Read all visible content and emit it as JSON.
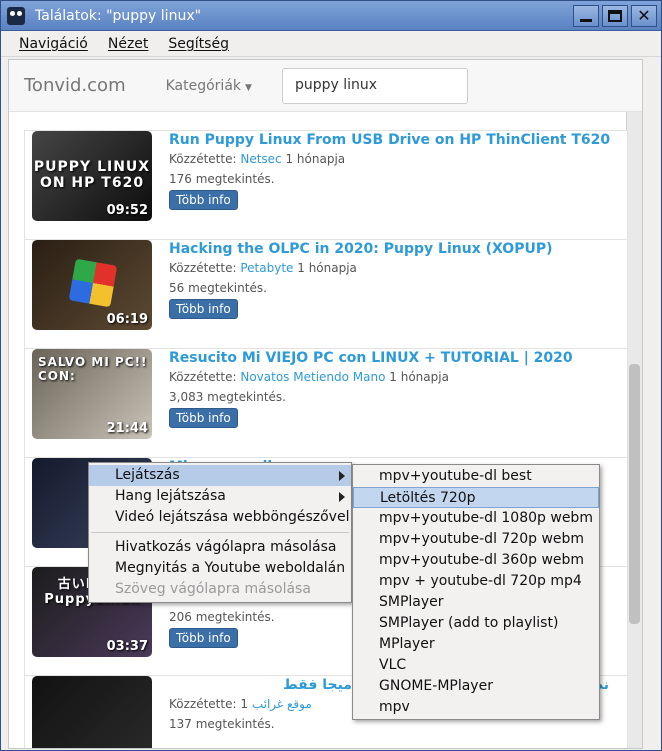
{
  "window": {
    "title": "Találatok: \"puppy linux\""
  },
  "menubar": [
    "Navigáció",
    "Nézet",
    "Segítség"
  ],
  "site": {
    "brand": "Tonvid.com",
    "categories": "Kategóriák",
    "search_value": "puppy linux"
  },
  "results": [
    {
      "title": "Run Puppy Linux From USB Drive on HP ThinClient T620",
      "prefix": "Közzétette:",
      "author": "Netsec",
      "age": "1 hónapja",
      "views": "176 megtekintés.",
      "button": "Több info",
      "duration": "09:52",
      "thumb_caption": "PUPPY LINUX ON HP T620"
    },
    {
      "title": "Hacking the OLPC in 2020: Puppy Linux (XOPUP)",
      "prefix": "Közzétette:",
      "author": "Petabyte",
      "age": "1 hónapja",
      "views": "56 megtekintés.",
      "button": "Több info",
      "duration": "06:19",
      "thumb_caption": ""
    },
    {
      "title": "Resucito Mi VIEJO PC con LINUX + TUTORIAL | 2020",
      "prefix": "Közzétette:",
      "author": "Novatos Metiendo Mano",
      "age": "1 hónapja",
      "views": "3,083 megtekintés.",
      "button": "Több info",
      "duration": "21:44",
      "thumb_caption": "SALVO MI PC!! CON:"
    },
    {
      "title": "Mi... puppy linux",
      "prefix": "",
      "author": "",
      "age": "",
      "views": "",
      "button": "",
      "duration": "",
      "thumb_caption": ""
    },
    {
      "title": "",
      "prefix": "",
      "author": "",
      "age": "",
      "views": "206 megtekintés.",
      "button": "Több info",
      "duration": "03:37",
      "thumb_caption": "古いPC で PuppyLinux"
    },
    {
      "title": "نظام USB حول أي فلاشة بحجم 300 ميجا فقط",
      "prefix": "Közzétette:",
      "author": "موقع غرائب",
      "age": "1",
      "views": "137 megtekintés.",
      "button": "",
      "duration": "",
      "thumb_caption": ""
    }
  ],
  "context_menu": {
    "items": [
      {
        "label": "Lejátszás",
        "submenu": true,
        "active": true
      },
      {
        "label": "Hang lejátszása",
        "submenu": true
      },
      {
        "label": "Videó lejátszása webböngészővel"
      },
      {
        "separator": true
      },
      {
        "label": "Hivatkozás vágólapra másolása"
      },
      {
        "label": "Megnyitás a Youtube weboldalán"
      },
      {
        "label": "Szöveg vágólapra másolása",
        "disabled": true
      }
    ]
  },
  "submenu": {
    "items": [
      "mpv+youtube-dl best",
      "Letöltés  720p",
      "mpv+youtube-dl 1080p webm",
      "mpv+youtube-dl 720p webm",
      "mpv+youtube-dl 360p webm",
      "mpv + youtube-dl 720p mp4",
      "SMPlayer",
      "SMPlayer (add to playlist)",
      "MPlayer",
      "VLC",
      "GNOME-MPlayer",
      "mpv"
    ],
    "active_index": 1
  }
}
